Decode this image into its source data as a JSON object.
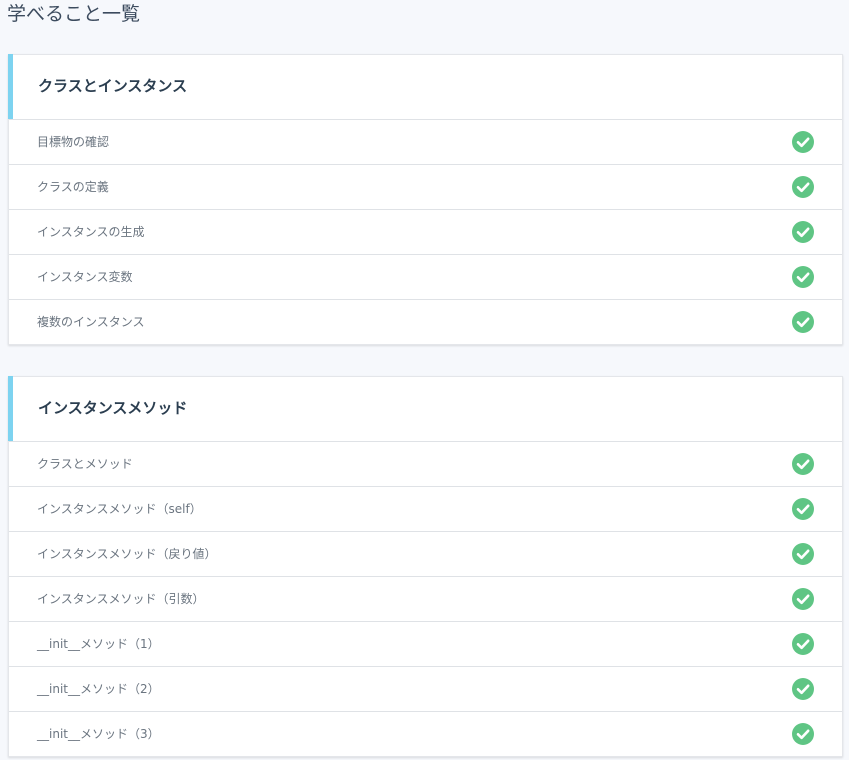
{
  "page": {
    "title": "学べること一覧"
  },
  "colors": {
    "accent": "#7dd3f0",
    "check": "#5fc584",
    "title_text": "#2b3e50",
    "row_text": "#6b7580"
  },
  "icons": {
    "completed": "check-circle-icon"
  },
  "sections": [
    {
      "title": "クラスとインスタンス",
      "lessons": [
        {
          "label": "目標物の確認",
          "completed": true
        },
        {
          "label": "クラスの定義",
          "completed": true
        },
        {
          "label": "インスタンスの生成",
          "completed": true
        },
        {
          "label": "インスタンス変数",
          "completed": true
        },
        {
          "label": "複数のインスタンス",
          "completed": true
        }
      ]
    },
    {
      "title": "インスタンスメソッド",
      "lessons": [
        {
          "label": "クラスとメソッド",
          "completed": true
        },
        {
          "label": "インスタンスメソッド（self）",
          "completed": true
        },
        {
          "label": "インスタンスメソッド（戻り値）",
          "completed": true
        },
        {
          "label": "インスタンスメソッド（引数）",
          "completed": true
        },
        {
          "label": "__init__メソッド（1）",
          "completed": true
        },
        {
          "label": "__init__メソッド（2）",
          "completed": true
        },
        {
          "label": "__init__メソッド（3）",
          "completed": true
        }
      ]
    }
  ]
}
